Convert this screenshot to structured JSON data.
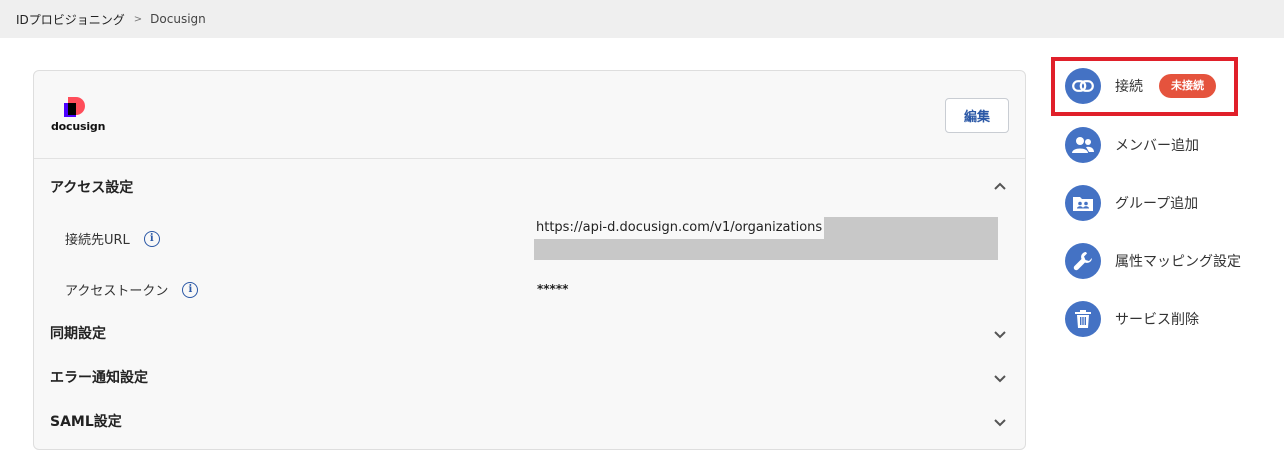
{
  "breadcrumb": {
    "root": "IDプロビジョニング",
    "separator": ">",
    "current": "Docusign"
  },
  "service": {
    "logo_text": "docusign",
    "edit_label": "編集"
  },
  "sections": {
    "access": {
      "title": "アクセス設定",
      "fields": {
        "url_label": "接続先URL",
        "url_value": "https://api-d.docusign.com/v1/organizations",
        "token_label": "アクセストークン",
        "token_value": "*****"
      },
      "info_glyph": "i"
    },
    "sync": {
      "title": "同期設定"
    },
    "error": {
      "title": "エラー通知設定"
    },
    "saml": {
      "title": "SAML設定"
    }
  },
  "sidebar": {
    "items": [
      {
        "label": "接続",
        "icon": "link-icon",
        "badge": "未接続"
      },
      {
        "label": "メンバー追加",
        "icon": "people-icon"
      },
      {
        "label": "グループ追加",
        "icon": "group-folder-icon"
      },
      {
        "label": "属性マッピング設定",
        "icon": "wrench-icon"
      },
      {
        "label": "サービス削除",
        "icon": "trash-icon"
      }
    ]
  },
  "colors": {
    "accent": "#4472c4",
    "badge": "#e5533d",
    "highlight": "#e0202a",
    "link_text": "#2b58a6"
  }
}
